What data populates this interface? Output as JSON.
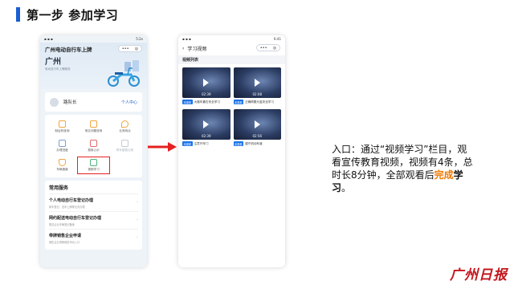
{
  "header": {
    "title": "第一步 参加学习"
  },
  "left_phone": {
    "status_time": "5:2x",
    "app_title": "广州电动自行车上牌",
    "city": "广州",
    "subtitle": "电动自行车上牌服务",
    "user_name": "路队长",
    "user_center": "个人中心",
    "grid": [
      {
        "label": "制证码查询",
        "color": "#f0a640",
        "dim": false
      },
      {
        "label": "常见问题咨询",
        "color": "#f0a640",
        "dim": false
      },
      {
        "label": "业务网点",
        "color": "#f0a640",
        "dim": false
      },
      {
        "label": "办理进度",
        "color": "#7c9cd6",
        "dim": false
      },
      {
        "label": "费用公示",
        "color": "#e36a6a",
        "dim": false
      },
      {
        "label": "购车缴费记录",
        "color": "#c5ccd6",
        "dim": true
      },
      {
        "label": "车辆报废",
        "color": "#f0a640",
        "dim": false
      },
      {
        "label": "视频学习",
        "color": "#4fb37a",
        "dim": false
      }
    ],
    "services_title": "常用服务",
    "services": [
      {
        "name": "个人电动自行车登记办理",
        "desc": "新车登记、旧车上牌等业务办理"
      },
      {
        "name": "网约配送电动自行车登记办理",
        "desc": "配送企业车辆登记备案"
      },
      {
        "name": "带牌销售企业申请",
        "desc": "销售企业带牌销售申请入口"
      }
    ]
  },
  "right_phone": {
    "status_time": "6:41",
    "nav_title": "学习视频",
    "list_title": "视频列表",
    "videos": [
      {
        "duration": "02:39",
        "tag": "未观看",
        "title": "大路车靠右安全学习"
      },
      {
        "duration": "02:08",
        "tag": "未观看",
        "title": "正确佩戴头盔安全学习"
      },
      {
        "duration": "02:39",
        "tag": "未观看",
        "title": "注意开车门"
      },
      {
        "duration": "02:56",
        "tag": "未观看",
        "title": "遵守机动车道"
      }
    ]
  },
  "description": {
    "p1": "入口：通过“视频学习”栏目，观看宣传教育视频，视频有4条，总时长8分钟，全部观看后",
    "p2": "完成",
    "p3": "学习",
    "p4": "。"
  },
  "logo": "广州日报"
}
